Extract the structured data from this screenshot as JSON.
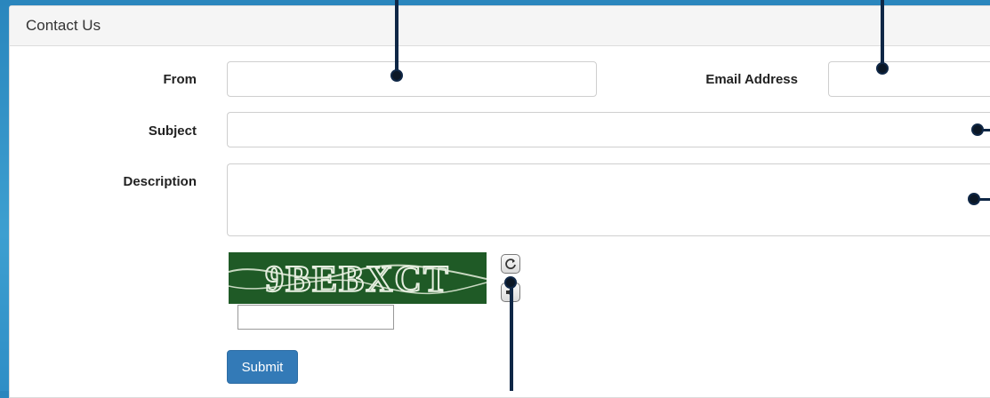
{
  "panel": {
    "title": "Contact Us"
  },
  "form": {
    "from_label": "From",
    "from_value": "",
    "email_label": "Email Address",
    "email_value": "",
    "subject_label": "Subject",
    "subject_value": "",
    "description_label": "Description",
    "description_value": "",
    "captcha_answer": "",
    "submit_label": "Submit"
  },
  "captcha": {
    "text": "9BEBXCT"
  },
  "icons": {
    "refresh": "refresh-icon",
    "audio": "audio-icon"
  },
  "colors": {
    "accent": "#337ab7",
    "captcha_bg": "#1f5a26",
    "annotation": "#0f2746"
  }
}
